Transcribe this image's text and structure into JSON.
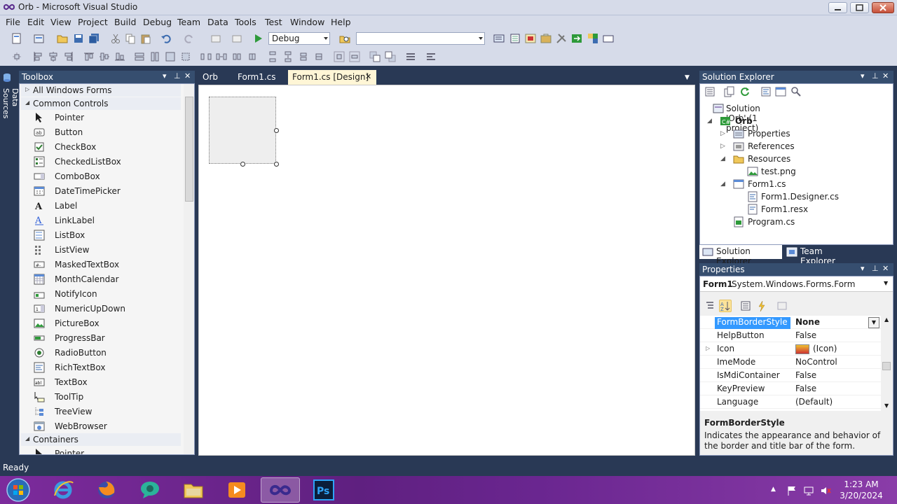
{
  "window": {
    "title": "Orb - Microsoft Visual Studio"
  },
  "menu": [
    "File",
    "Edit",
    "View",
    "Project",
    "Build",
    "Debug",
    "Team",
    "Data",
    "Tools",
    "Test",
    "Window",
    "Help"
  ],
  "toolbar": {
    "config_value": "Debug",
    "platform_value": ""
  },
  "side_tab": {
    "label": "Data Sources"
  },
  "toolbox": {
    "title": "Toolbox",
    "groups": [
      {
        "label": "All Windows Forms",
        "expanded": false
      },
      {
        "label": "Common Controls",
        "expanded": true
      },
      {
        "label": "Containers",
        "expanded": true
      }
    ],
    "items": [
      "Pointer",
      "Button",
      "CheckBox",
      "CheckedListBox",
      "ComboBox",
      "DateTimePicker",
      "Label",
      "LinkLabel",
      "ListBox",
      "ListView",
      "MaskedTextBox",
      "MonthCalendar",
      "NotifyIcon",
      "NumericUpDown",
      "PictureBox",
      "ProgressBar",
      "RadioButton",
      "RichTextBox",
      "TextBox",
      "ToolTip",
      "TreeView",
      "WebBrowser"
    ],
    "containers_first": "Pointer"
  },
  "tabs": [
    {
      "label": "Orb",
      "active": false
    },
    {
      "label": "Form1.cs",
      "active": false
    },
    {
      "label": "Form1.cs [Design]",
      "active": true
    }
  ],
  "solution_explorer": {
    "title": "Solution Explorer",
    "nodes": [
      {
        "label": "Solution 'Orb' (1 project)"
      },
      {
        "label": "Orb"
      },
      {
        "label": "Properties"
      },
      {
        "label": "References"
      },
      {
        "label": "Resources"
      },
      {
        "label": "test.png"
      },
      {
        "label": "Form1.cs"
      },
      {
        "label": "Form1.Designer.cs"
      },
      {
        "label": "Form1.resx"
      },
      {
        "label": "Program.cs"
      }
    ],
    "bottom_tabs": [
      "Solution Explorer",
      "Team Explorer"
    ]
  },
  "properties": {
    "title": "Properties",
    "object_name": "Form1",
    "object_type": "System.Windows.Forms.Form",
    "rows": [
      {
        "name": "FormBorderStyle",
        "value": "None",
        "selected": true
      },
      {
        "name": "HelpButton",
        "value": "False"
      },
      {
        "name": "Icon",
        "value": "(Icon)"
      },
      {
        "name": "ImeMode",
        "value": "NoControl"
      },
      {
        "name": "IsMdiContainer",
        "value": "False"
      },
      {
        "name": "KeyPreview",
        "value": "False"
      },
      {
        "name": "Language",
        "value": "(Default)"
      }
    ],
    "description_title": "FormBorderStyle",
    "description_text": "Indicates the appearance and behavior of the border and title bar of the form."
  },
  "status": {
    "text": "Ready"
  },
  "taskbar": {
    "time": "1:23 AM",
    "date": "3/20/2024"
  },
  "colors": {
    "chrome": "#d6dbe9",
    "panel_dark": "#293955",
    "panel_header": "#364e6f",
    "selection": "#3399ff",
    "tab_active": "#fff6d6"
  }
}
